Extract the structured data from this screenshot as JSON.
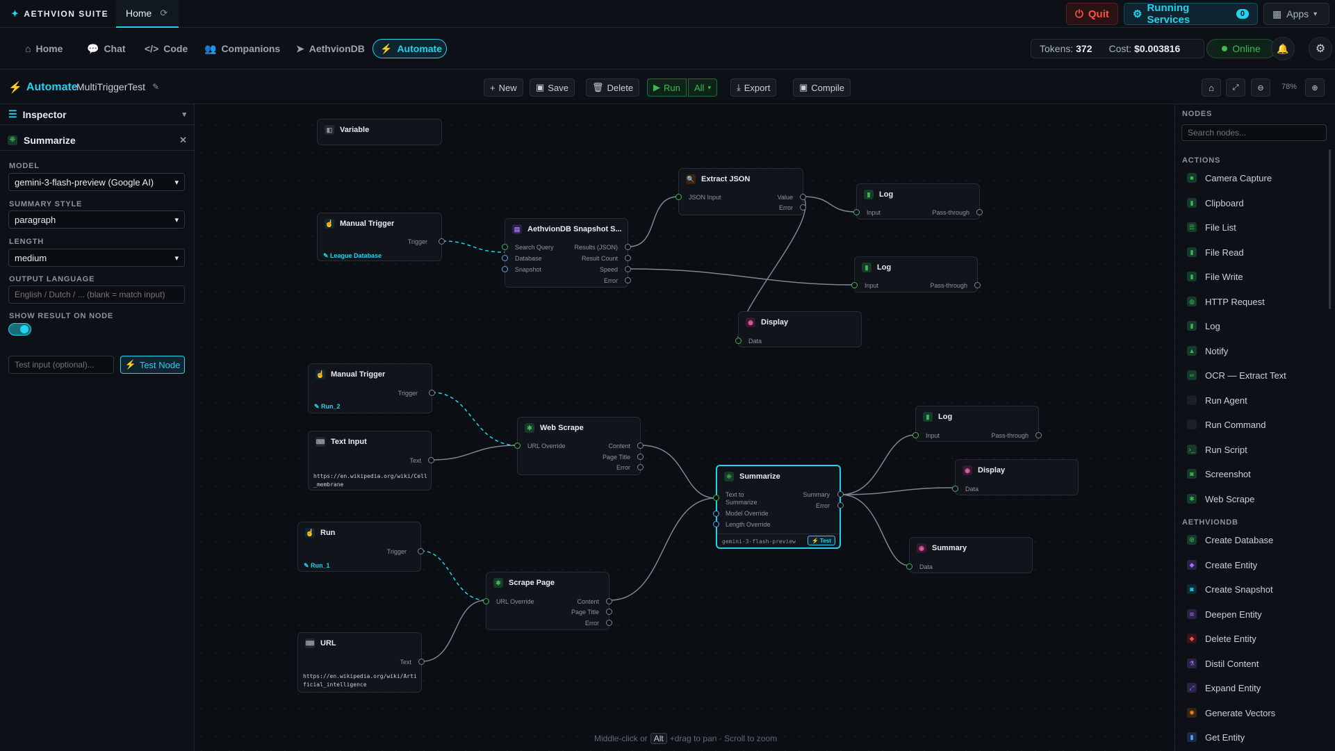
{
  "topbar": {
    "brand": "AETHVION SUITE",
    "home_tab": "Home",
    "quit_label": "Quit",
    "running_label": "Running Services",
    "running_count": "0",
    "apps_label": "Apps"
  },
  "nav": {
    "items": [
      "Home",
      "Chat",
      "Code",
      "Companions",
      "AethvionDB",
      "Automate"
    ],
    "active": "Automate",
    "tokens_label": "Tokens:",
    "tokens_value": "372",
    "cost_label": "Cost:",
    "cost_value": "$0.003816",
    "status": "Online"
  },
  "toolbar": {
    "title": "Automate",
    "workflow_name": "MultiTriggerTest",
    "new_label": "New",
    "save_label": "Save",
    "delete_label": "Delete",
    "run_label": "Run",
    "run_scope": "All",
    "export_label": "Export",
    "compile_label": "Compile",
    "zoom": "78%"
  },
  "inspector": {
    "header": "Inspector",
    "node_title": "Summarize",
    "model_label": "MODEL",
    "model_value": "gemini-3-flash-preview (Google AI)",
    "style_label": "SUMMARY STYLE",
    "style_value": "paragraph",
    "length_label": "LENGTH",
    "length_value": "medium",
    "language_label": "OUTPUT LANGUAGE",
    "language_placeholder": "English / Dutch / ... (blank = match input)",
    "show_result_label": "SHOW RESULT ON NODE",
    "show_result_on": true,
    "test_placeholder": "Test input (optional)...",
    "test_button": "Test Node"
  },
  "canvas": {
    "hint_pre": "Middle-click or",
    "hint_key": "Alt",
    "hint_post": "+drag to pan · Scroll to zoom",
    "nodes": {
      "variable": {
        "title": "Variable"
      },
      "manual_trigger_1": {
        "title": "Manual Trigger",
        "out": "Trigger",
        "chip": "League Database"
      },
      "snapshot": {
        "title": "AethvionDB Snapshot S...",
        "in": [
          "Search Query",
          "Database",
          "Snapshot"
        ],
        "out": [
          "Results (JSON)",
          "Result Count",
          "Speed",
          "Error"
        ]
      },
      "extract_json": {
        "title": "Extract JSON",
        "in": "JSON Input",
        "out": [
          "Value",
          "Error"
        ]
      },
      "log_1": {
        "title": "Log",
        "in": "Input",
        "out": "Pass-through"
      },
      "log_2": {
        "title": "Log",
        "in": "Input",
        "out": "Pass-through"
      },
      "display_1": {
        "title": "Display",
        "in": "Data"
      },
      "manual_trigger_2": {
        "title": "Manual Trigger",
        "out": "Trigger",
        "chip": "Run_2"
      },
      "text_input": {
        "title": "Text Input",
        "out": "Text",
        "value": "https://en.wikipedia.org/wiki/Cell_membrane"
      },
      "web_scrape": {
        "title": "Web Scrape",
        "in": "URL Override",
        "out": [
          "Content",
          "Page Title",
          "Error"
        ]
      },
      "summarize": {
        "title": "Summarize",
        "in": [
          "Text to Summarize",
          "Model Override",
          "Length Override"
        ],
        "out": [
          "Summary",
          "Error"
        ],
        "model": "gemini-3-flash-preview",
        "test": "Test"
      },
      "log_3": {
        "title": "Log",
        "in": "Input",
        "out": "Pass-through"
      },
      "display_2": {
        "title": "Display",
        "in": "Data"
      },
      "summary": {
        "title": "Summary",
        "in": "Data"
      },
      "run": {
        "title": "Run",
        "out": "Trigger",
        "chip": "Run_1"
      },
      "scrape_page": {
        "title": "Scrape Page",
        "in": "URL Override",
        "out": [
          "Content",
          "Page Title",
          "Error"
        ]
      },
      "url": {
        "title": "URL",
        "out": "Text",
        "value": "https://en.wikipedia.org/wiki/Artificial_intelligence"
      }
    }
  },
  "nodes_panel": {
    "header": "NODES",
    "search_placeholder": "Search nodes...",
    "actions_label": "ACTIONS",
    "actions": [
      "Camera Capture",
      "Clipboard",
      "File List",
      "File Read",
      "File Write",
      "HTTP Request",
      "Log",
      "Notify",
      "OCR — Extract Text",
      "Run Agent",
      "Run Command",
      "Run Script",
      "Screenshot",
      "Web Scrape"
    ],
    "db_label": "AETHVIONDB",
    "db": [
      "Create Database",
      "Create Entity",
      "Create Snapshot",
      "Deepen Entity",
      "Delete Entity",
      "Distil Content",
      "Expand Entity",
      "Generate Vectors",
      "Get Entity"
    ]
  },
  "colors": {
    "accent": "#22d3ee",
    "green": "#3fb950",
    "red": "#f85149",
    "purple": "#a371f7",
    "pink": "#db61a2",
    "blue": "#58a6ff"
  }
}
